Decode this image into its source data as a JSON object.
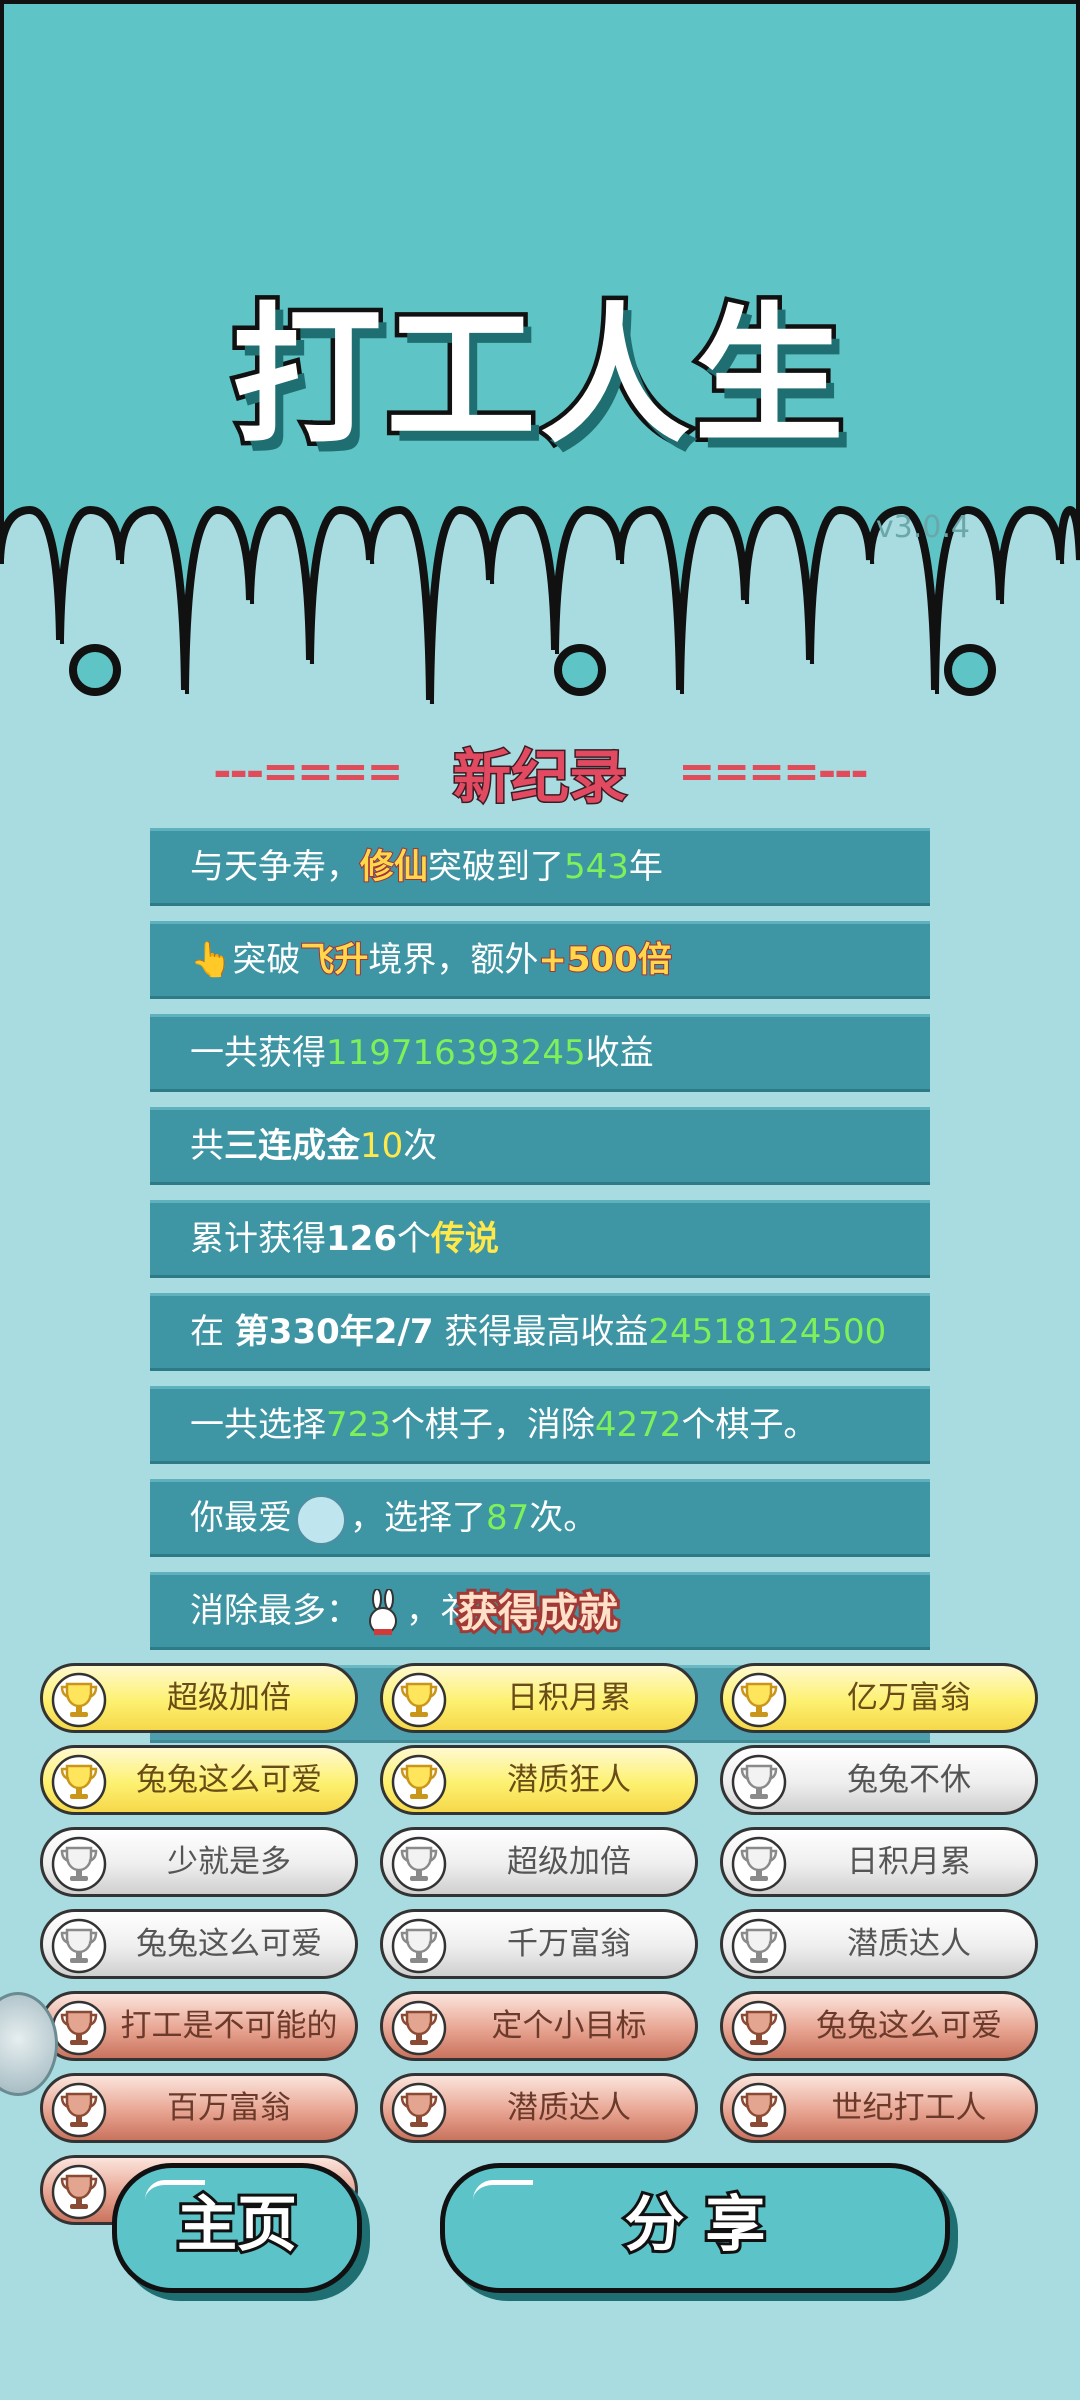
{
  "app": {
    "title": "打工人生",
    "version": "v3.0.4"
  },
  "colors": {
    "bg_top": "#5ec4c6",
    "bg_bottom": "#a9dce1",
    "row_bg": "#3e95a4",
    "green": "#7df05a",
    "yellow": "#ffe84a",
    "red_title": "#e24a62"
  },
  "record": {
    "left_deco": "---====",
    "title": "新纪录",
    "right_deco": "====---",
    "rows": [
      {
        "p1": "与天争寿，",
        "h1": "修仙",
        "p2": "突破到了",
        "n1": "543",
        "p3": "年"
      },
      {
        "icon": "pointing-hand-icon",
        "p1": "突破",
        "h1": "飞升",
        "p2": "境界，额外",
        "h2": "+500倍"
      },
      {
        "p1": "一共获得",
        "n1": "119716393245",
        "p2": "收益"
      },
      {
        "p1": "共",
        "b1": "三连成金",
        "n1": "10",
        "p2": "次"
      },
      {
        "p1": "累计获得",
        "b1": "126",
        "p2": "个",
        "n1": "传说"
      },
      {
        "p1": "在 ",
        "b1": "第330年2/7",
        "p2": " 获得最高收益",
        "n1": "24518124500"
      },
      {
        "p1": "一共选择",
        "n1": "723",
        "p2": "个棋子，消除",
        "n2": "4272",
        "p3": "个棋子。"
      },
      {
        "p1": "你最爱",
        "icon": "rice-bowl-icon",
        "p2": "，选择了",
        "n1": "87",
        "p3": "次。"
      },
      {
        "p1": "消除最多：",
        "icon": "bunny-icon",
        "p2": "，礻"
      }
    ]
  },
  "achievement_popup": "获得成就",
  "achievements": [
    {
      "label": "超级加倍",
      "tier": "gold"
    },
    {
      "label": "日积月累",
      "tier": "gold"
    },
    {
      "label": "亿万富翁",
      "tier": "gold"
    },
    {
      "label": "兔兔这么可爱",
      "tier": "gold"
    },
    {
      "label": "潜质狂人",
      "tier": "gold"
    },
    {
      "label": "兔兔不休",
      "tier": "silver"
    },
    {
      "label": "少就是多",
      "tier": "silver"
    },
    {
      "label": "超级加倍",
      "tier": "silver"
    },
    {
      "label": "日积月累",
      "tier": "silver"
    },
    {
      "label": "兔兔这么可爱",
      "tier": "silver"
    },
    {
      "label": "千万富翁",
      "tier": "silver"
    },
    {
      "label": "潜质达人",
      "tier": "silver"
    },
    {
      "label": "打工是不可能的",
      "tier": "bronze"
    },
    {
      "label": "定个小目标",
      "tier": "bronze"
    },
    {
      "label": "兔兔这么可爱",
      "tier": "bronze"
    },
    {
      "label": "百万富翁",
      "tier": "bronze"
    },
    {
      "label": "潜质达人",
      "tier": "bronze"
    },
    {
      "label": "世纪打工人",
      "tier": "bronze"
    },
    {
      "label": "",
      "tier": "bronze"
    }
  ],
  "buttons": {
    "home": "主页",
    "share": "分 享"
  }
}
